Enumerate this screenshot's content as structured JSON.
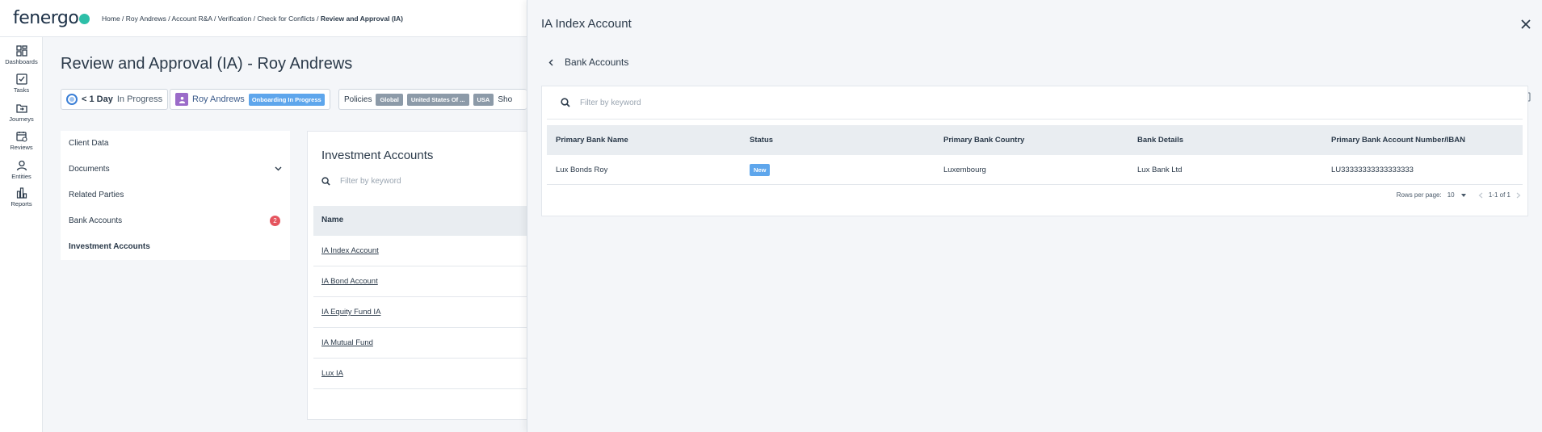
{
  "header": {
    "logo_text": "fenergo",
    "breadcrumb": {
      "items": [
        "Home",
        "Roy Andrews",
        "Account R&A",
        "Verification",
        "Check for Conflicts"
      ],
      "separator": " / ",
      "current": "Review and Approval (IA)"
    }
  },
  "nav": {
    "items": [
      {
        "label": "Dashboards",
        "icon": "dashboard-icon"
      },
      {
        "label": "Tasks",
        "icon": "tasks-icon"
      },
      {
        "label": "Journeys",
        "icon": "journeys-icon"
      },
      {
        "label": "Reviews",
        "icon": "reviews-icon"
      },
      {
        "label": "Entities",
        "icon": "entities-icon"
      },
      {
        "label": "Reports",
        "icon": "reports-icon"
      }
    ]
  },
  "page": {
    "title": "Review and Approval (IA) - Roy Andrews",
    "progress_chip": {
      "duration": "< 1 Day",
      "status": "In Progress"
    },
    "entity_chip": {
      "name": "Roy Andrews",
      "badge": "Onboarding In Progress"
    },
    "policies_chip": {
      "label": "Policies",
      "tags": [
        "Global",
        "United States Of ...",
        "USA"
      ],
      "more": "Sho"
    }
  },
  "side_menu": {
    "items": [
      {
        "label": "Client Data"
      },
      {
        "label": "Documents"
      },
      {
        "label": "Related Parties"
      },
      {
        "label": "Bank Accounts",
        "count": "2"
      },
      {
        "label": "Investment Accounts"
      }
    ]
  },
  "investment_accounts": {
    "title": "Investment Accounts",
    "filter_placeholder": "Filter by keyword",
    "column_name": "Name",
    "rows": [
      "IA Index Account",
      "IA Bond Account",
      "IA Equity Fund IA",
      "IA Mutual Fund",
      "Lux IA"
    ]
  },
  "drawer": {
    "title": "IA Index Account",
    "back_label": "Bank Accounts",
    "filter_placeholder": "Filter by keyword",
    "columns": [
      "Primary Bank Name",
      "Status",
      "Primary Bank Country",
      "Bank Details",
      "Primary Bank Account Number/IBAN"
    ],
    "rows": [
      {
        "bank_name": "Lux Bonds Roy",
        "status": "New",
        "country": "Luxembourg",
        "details": "Lux Bank Ltd",
        "iban": "LU33333333333333333"
      }
    ],
    "pagination": {
      "rows_per_page_label": "Rows per page:",
      "rows_per_page": "10",
      "range": "1-1 of 1"
    }
  },
  "colors": {
    "accent_blue": "#5ea6ec",
    "logo_dot": "#2dbfa8",
    "count_badge": "#e5545e",
    "tag_grey": "#8c9aa8",
    "avatar_purple": "#9b6bc9"
  }
}
